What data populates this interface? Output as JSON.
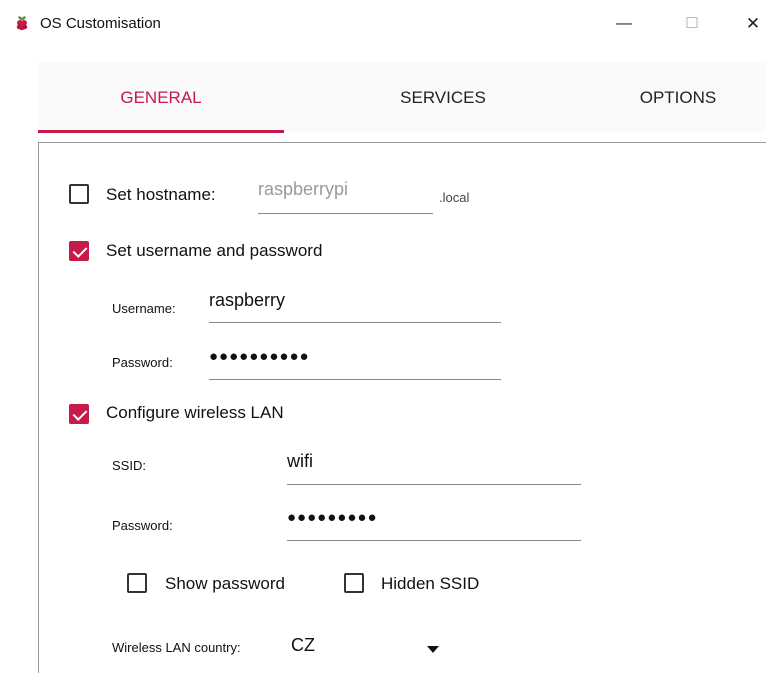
{
  "window": {
    "title": "OS Customisation",
    "minimize_glyph": "—",
    "maximize_glyph": "☐",
    "close_glyph": "✕"
  },
  "tabs": [
    {
      "label": "GENERAL",
      "active": true
    },
    {
      "label": "SERVICES",
      "active": false
    },
    {
      "label": "OPTIONS",
      "active": false
    }
  ],
  "general": {
    "hostname": {
      "label": "Set hostname:",
      "checked": false,
      "placeholder": "raspberrypi",
      "suffix": ".local"
    },
    "user": {
      "label": "Set username and password",
      "checked": true,
      "username_label": "Username:",
      "username_value": "raspberry",
      "password_label": "Password:",
      "password_value": "●●●●●●●●●●"
    },
    "wlan": {
      "label": "Configure wireless LAN",
      "checked": true,
      "ssid_label": "SSID:",
      "ssid_value": "wifi",
      "password_label": "Password:",
      "password_value": "●●●●●●●●●",
      "show_password_label": "Show password",
      "show_password_checked": false,
      "hidden_ssid_label": "Hidden SSID",
      "hidden_ssid_checked": false,
      "country_label": "Wireless LAN country:",
      "country_value": "CZ"
    }
  },
  "colors": {
    "accent": "#c51a4a"
  },
  "icons": {
    "app": "raspberry-pi-icon",
    "dropdown": "chevron-down-icon"
  }
}
